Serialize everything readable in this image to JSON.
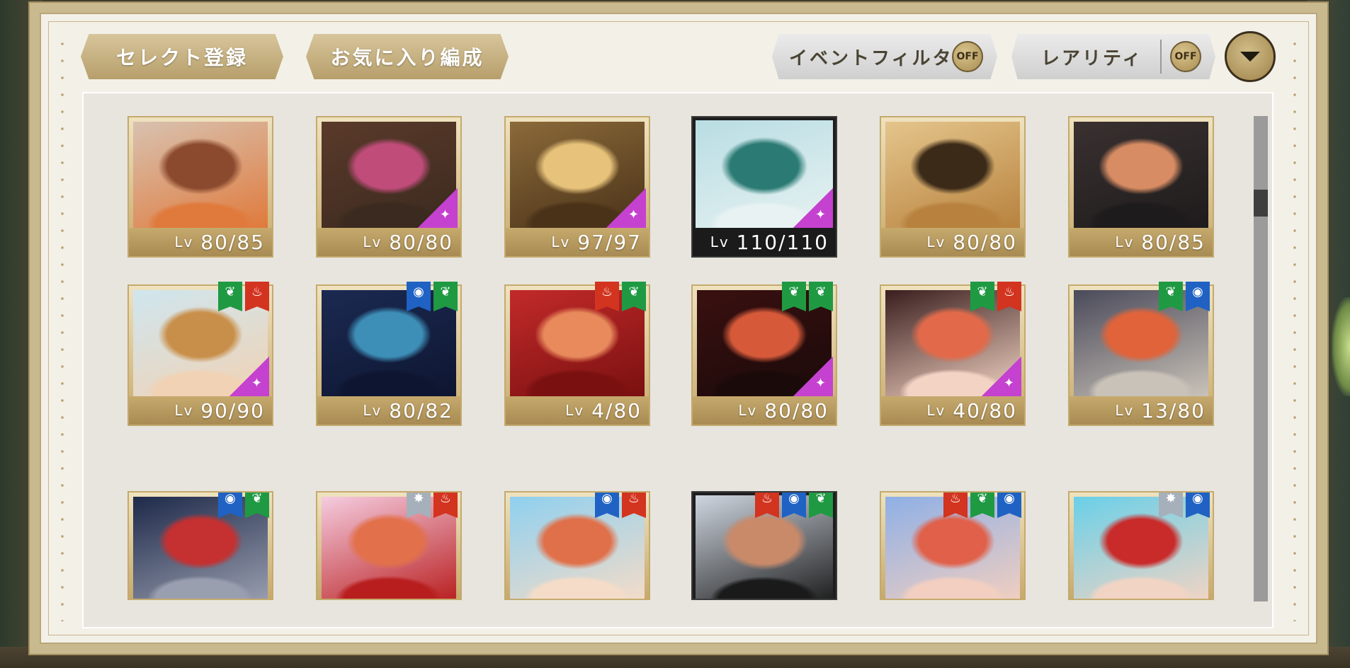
{
  "toolbar": {
    "select_register_label": "セレクト登録",
    "favorite_formation_label": "お気に入り編成",
    "event_filter_label": "イベントフィルタ",
    "event_filter_state": "OFF",
    "rarity_label": "レアリティ",
    "rarity_state": "OFF"
  },
  "lv_prefix": "Lv",
  "cards": [
    {
      "level": "80/85",
      "portrait": [
        "#d8c2b0",
        "#8b4a2e",
        "#e07a3c"
      ],
      "sparkle": false,
      "dark": false,
      "badges": []
    },
    {
      "level": "80/80",
      "portrait": [
        "#5a3a2a",
        "#c04c7a",
        "#3b2a1f"
      ],
      "sparkle": true,
      "dark": false,
      "badges": []
    },
    {
      "level": "97/97",
      "portrait": [
        "#8b6a3a",
        "#e6c27a",
        "#4a3218"
      ],
      "sparkle": true,
      "dark": false,
      "badges": []
    },
    {
      "level": "110/110",
      "portrait": [
        "#b8dde3",
        "#2b7b74",
        "#e8f2f2"
      ],
      "sparkle": true,
      "dark": true,
      "badges": []
    },
    {
      "level": "80/80",
      "portrait": [
        "#e4c58c",
        "#3b2a18",
        "#b8823e"
      ],
      "sparkle": false,
      "dark": false,
      "badges": []
    },
    {
      "level": "80/85",
      "portrait": [
        "#3a3130",
        "#d78c63",
        "#1e1b1c"
      ],
      "sparkle": false,
      "dark": false,
      "badges": []
    },
    {
      "level": "90/90",
      "portrait": [
        "#cfe6ef",
        "#c88f4a",
        "#f1d2b4"
      ],
      "sparkle": true,
      "dark": false,
      "badges": [
        "green",
        "red"
      ]
    },
    {
      "level": "80/82",
      "portrait": [
        "#1b2a52",
        "#3d8fb8",
        "#0e1530"
      ],
      "sparkle": false,
      "dark": false,
      "badges": [
        "blue",
        "green"
      ]
    },
    {
      "level": "4/80",
      "portrait": [
        "#c22a2a",
        "#e88a5c",
        "#7a1010"
      ],
      "sparkle": false,
      "dark": false,
      "badges": [
        "red",
        "green"
      ]
    },
    {
      "level": "80/80",
      "portrait": [
        "#3a1010",
        "#d65a3a",
        "#1a0a0a"
      ],
      "sparkle": true,
      "dark": false,
      "badges": [
        "green",
        "green"
      ]
    },
    {
      "level": "40/80",
      "portrait": [
        "#3a1e1e",
        "#e26a4a",
        "#f3d4c4"
      ],
      "sparkle": true,
      "dark": false,
      "badges": [
        "green",
        "red"
      ]
    },
    {
      "level": "13/80",
      "portrait": [
        "#4a4a5a",
        "#e0633a",
        "#c9c2b8"
      ],
      "sparkle": false,
      "dark": false,
      "badges": [
        "green",
        "blue"
      ]
    },
    {
      "level": "",
      "portrait": [
        "#1e2a4a",
        "#c53030",
        "#9a9fb0"
      ],
      "sparkle": false,
      "dark": false,
      "badges": [
        "blue",
        "green"
      ]
    },
    {
      "level": "",
      "portrait": [
        "#f5cce0",
        "#e2704a",
        "#b81e1e"
      ],
      "sparkle": false,
      "dark": false,
      "badges": [
        "grey",
        "red"
      ]
    },
    {
      "level": "",
      "portrait": [
        "#8fd0ef",
        "#e0704a",
        "#f5dcc8"
      ],
      "sparkle": false,
      "dark": false,
      "badges": [
        "blue",
        "red"
      ]
    },
    {
      "level": "",
      "portrait": [
        "#cfd6e0",
        "#c98a6a",
        "#1a1a1a"
      ],
      "sparkle": false,
      "dark": true,
      "badges": [
        "red",
        "blue",
        "green"
      ]
    },
    {
      "level": "",
      "portrait": [
        "#8fb0e6",
        "#e0604a",
        "#f2cfc0"
      ],
      "sparkle": false,
      "dark": false,
      "badges": [
        "red",
        "green",
        "blue"
      ]
    },
    {
      "level": "",
      "portrait": [
        "#6ad0e8",
        "#c92a2a",
        "#f2d4c4"
      ],
      "sparkle": false,
      "dark": false,
      "badges": [
        "grey",
        "blue"
      ]
    }
  ]
}
